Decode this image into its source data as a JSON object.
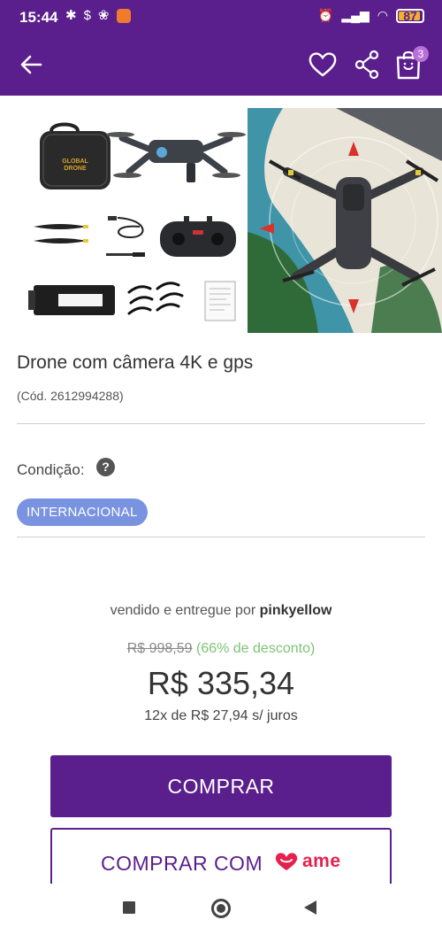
{
  "status_bar": {
    "time": "15:44",
    "battery": "87"
  },
  "app_bar": {
    "cart_count": "3",
    "icons": [
      "arrow-left-icon",
      "heart-icon",
      "share-icon",
      "shopping-bag-icon"
    ]
  },
  "product": {
    "image_left_labels": {
      "case_logo": "GLOBAL\nDRONE"
    },
    "title": "Drone com câmera 4K e gps",
    "code": "(Cód. 2612994288)",
    "condition_label": "Condição:",
    "help_glyph": "?",
    "condition_value": "INTERNACIONAL"
  },
  "offer": {
    "seller_prefix": "vendido e entregue por ",
    "seller_name": "pinkyellow",
    "old_price": "R$ 998,59",
    "discount": "(66% de desconto)",
    "price": "R$ 335,34",
    "installments": "12x de R$ 27,94 s/ juros"
  },
  "buttons": {
    "buy": "COMPRAR",
    "buy_with": "COMPRAR COM",
    "ame_brand": "ame"
  },
  "colors": {
    "brand_purple": "#5a1f8c",
    "chip_blue": "#7a93e0",
    "discount_green": "#7cc576",
    "ame_red": "#e5214e"
  }
}
